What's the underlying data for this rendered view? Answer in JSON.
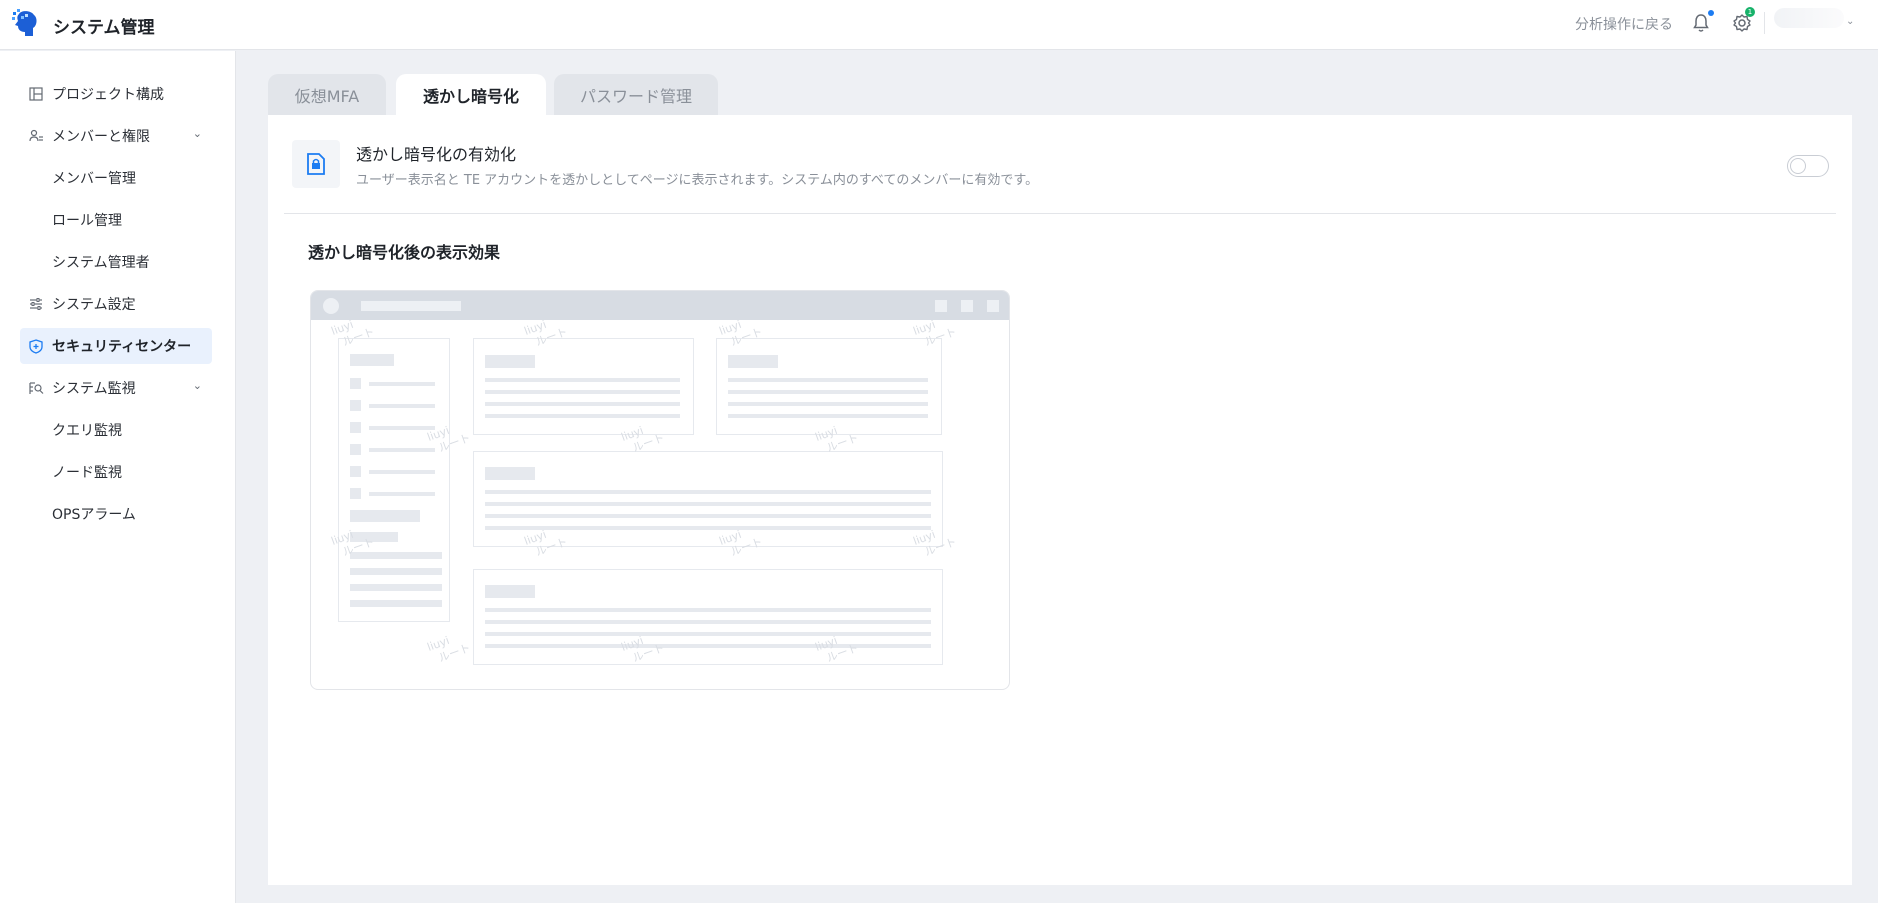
{
  "header": {
    "app_title": "システム管理",
    "back_link": "分析操作に戻る",
    "notification_badge": "",
    "settings_badge": "1",
    "logo_icon": "brain-logo-icon",
    "bell_icon": "bell-icon",
    "gear_icon": "gear-icon",
    "accent": "#1c7cf2"
  },
  "sidebar": {
    "items": [
      {
        "label": "プロジェクト構成",
        "icon": "layout-icon"
      },
      {
        "label": "メンバーと権限",
        "icon": "users-icon"
      },
      {
        "label": "メンバー管理"
      },
      {
        "label": "ロール管理"
      },
      {
        "label": "システム管理者"
      },
      {
        "label": "システム設定",
        "icon": "sliders-icon"
      },
      {
        "label": "セキュリティセンター",
        "icon": "shield-icon",
        "active": true
      },
      {
        "label": "システム監視",
        "icon": "monitor-search-icon"
      },
      {
        "label": "クエリ監視"
      },
      {
        "label": "ノード監視"
      },
      {
        "label": "OPSアラーム"
      }
    ]
  },
  "tabs": [
    {
      "label": "仮想MFA"
    },
    {
      "label": "透かし暗号化",
      "active": true
    },
    {
      "label": "パスワード管理"
    }
  ],
  "watermark_setting": {
    "title": "透かし暗号化の有効化",
    "description": "ユーザー表示名と TE アカウントを透かしとしてページに表示されます。システム内のすべてのメンバーに有効です。",
    "enabled": false,
    "icon": "lock-document-icon"
  },
  "preview": {
    "section_title": "透かし暗号化後の表示効果",
    "watermark_line1": "liuyi",
    "watermark_line2": "ルート"
  }
}
